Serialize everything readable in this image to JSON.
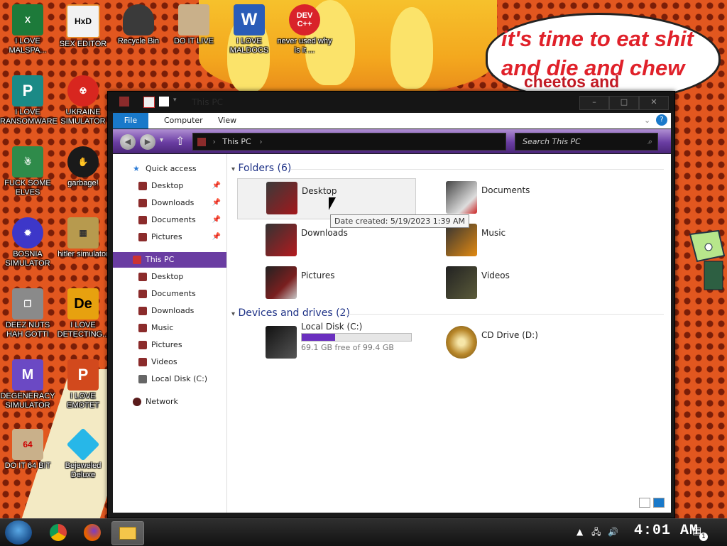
{
  "wallpaper": {
    "speech_text_line1": "it's time to eat shit",
    "speech_text_line2": "and die and chew",
    "speech_text_line3": "cheetos and",
    "speech_color": "#e0212a"
  },
  "desktop_icons": [
    {
      "label": "I LOVE MALSPA...",
      "icon": "excel-icon",
      "color": "#1d7a3a"
    },
    {
      "label": "SEX EDITOR",
      "icon": "hxd-icon",
      "color": "#f2f2f2"
    },
    {
      "label": "Recycle Bin",
      "icon": "recycle-bin-icon",
      "color": "#3a3a3a"
    },
    {
      "label": "DO IT LIVE",
      "icon": "portrait-icon",
      "color": "#c9b08a"
    },
    {
      "label": "I LOVE MALDOCS",
      "icon": "word-icon",
      "color": "#2a5cb8"
    },
    {
      "label": "never used why is it ...",
      "icon": "devcpp-icon",
      "color": "#d9232a"
    },
    {
      "label": "I LOVE RANSOMWARE",
      "icon": "publisher-icon",
      "color": "#1b8a86"
    },
    {
      "label": "UKRAINE SIMULATOR",
      "icon": "radiation-icon",
      "color": "#d8261f"
    },
    {
      "label": "FUCK SOME ELVES",
      "icon": "christmas-icon",
      "color": "#2f8b4a"
    },
    {
      "label": "garbage!",
      "icon": "garbage-icon",
      "color": "#1a1a1a"
    },
    {
      "label": "BOSNIA SIMULATOR",
      "icon": "virus-icon",
      "color": "#3d37c9"
    },
    {
      "label": "hitler simulator",
      "icon": "game-icon",
      "color": "#b79a4e"
    },
    {
      "label": "DEEZ NUTS HAH GOTTI",
      "icon": "windows-stack-icon",
      "color": "#8a8a8a"
    },
    {
      "label": "I LOVE DETECTING...",
      "icon": "die-icon",
      "color": "#e7a10f"
    },
    {
      "label": "DEGENERACY SIMULATOR",
      "icon": "mod-icon",
      "color": "#6b49c4"
    },
    {
      "label": "I LOVE EMOTET",
      "icon": "powerpoint-icon",
      "color": "#d2491d"
    },
    {
      "label": "DO IT 64 BIT",
      "icon": "portrait64-icon",
      "color": "#c9b08a"
    },
    {
      "label": "Bejeweled Deluxe",
      "icon": "gem-icon",
      "color": "#27b7e8"
    }
  ],
  "explorer": {
    "title": "This PC",
    "tabs": {
      "file": "File",
      "computer": "Computer",
      "view": "View"
    },
    "address": "This PC",
    "search_placeholder": "Search This PC",
    "nav": {
      "quick_access": "Quick access",
      "qa_desktop": "Desktop",
      "qa_downloads": "Downloads",
      "qa_documents": "Documents",
      "qa_pictures": "Pictures",
      "this_pc": "This PC",
      "pc_desktop": "Desktop",
      "pc_documents": "Documents",
      "pc_downloads": "Downloads",
      "pc_music": "Music",
      "pc_pictures": "Pictures",
      "pc_videos": "Videos",
      "pc_local_disk": "Local Disk (C:)",
      "network": "Network"
    },
    "folders_header": "Folders (6)",
    "folders": {
      "desktop": "Desktop",
      "documents": "Documents",
      "downloads": "Downloads",
      "music": "Music",
      "pictures": "Pictures",
      "videos": "Videos"
    },
    "devices_header": "Devices and drives (2)",
    "drives": {
      "c_name": "Local Disk (C:)",
      "c_free": "69.1 GB free of 99.4 GB",
      "c_used_fraction": 0.305,
      "d_name": "CD Drive (D:)"
    },
    "tooltip": "Date created: 5/19/2023 1:39 AM",
    "accent": "#6a3da2"
  },
  "taskbar": {
    "clock": "4:01 AM",
    "notification_count": "1"
  }
}
